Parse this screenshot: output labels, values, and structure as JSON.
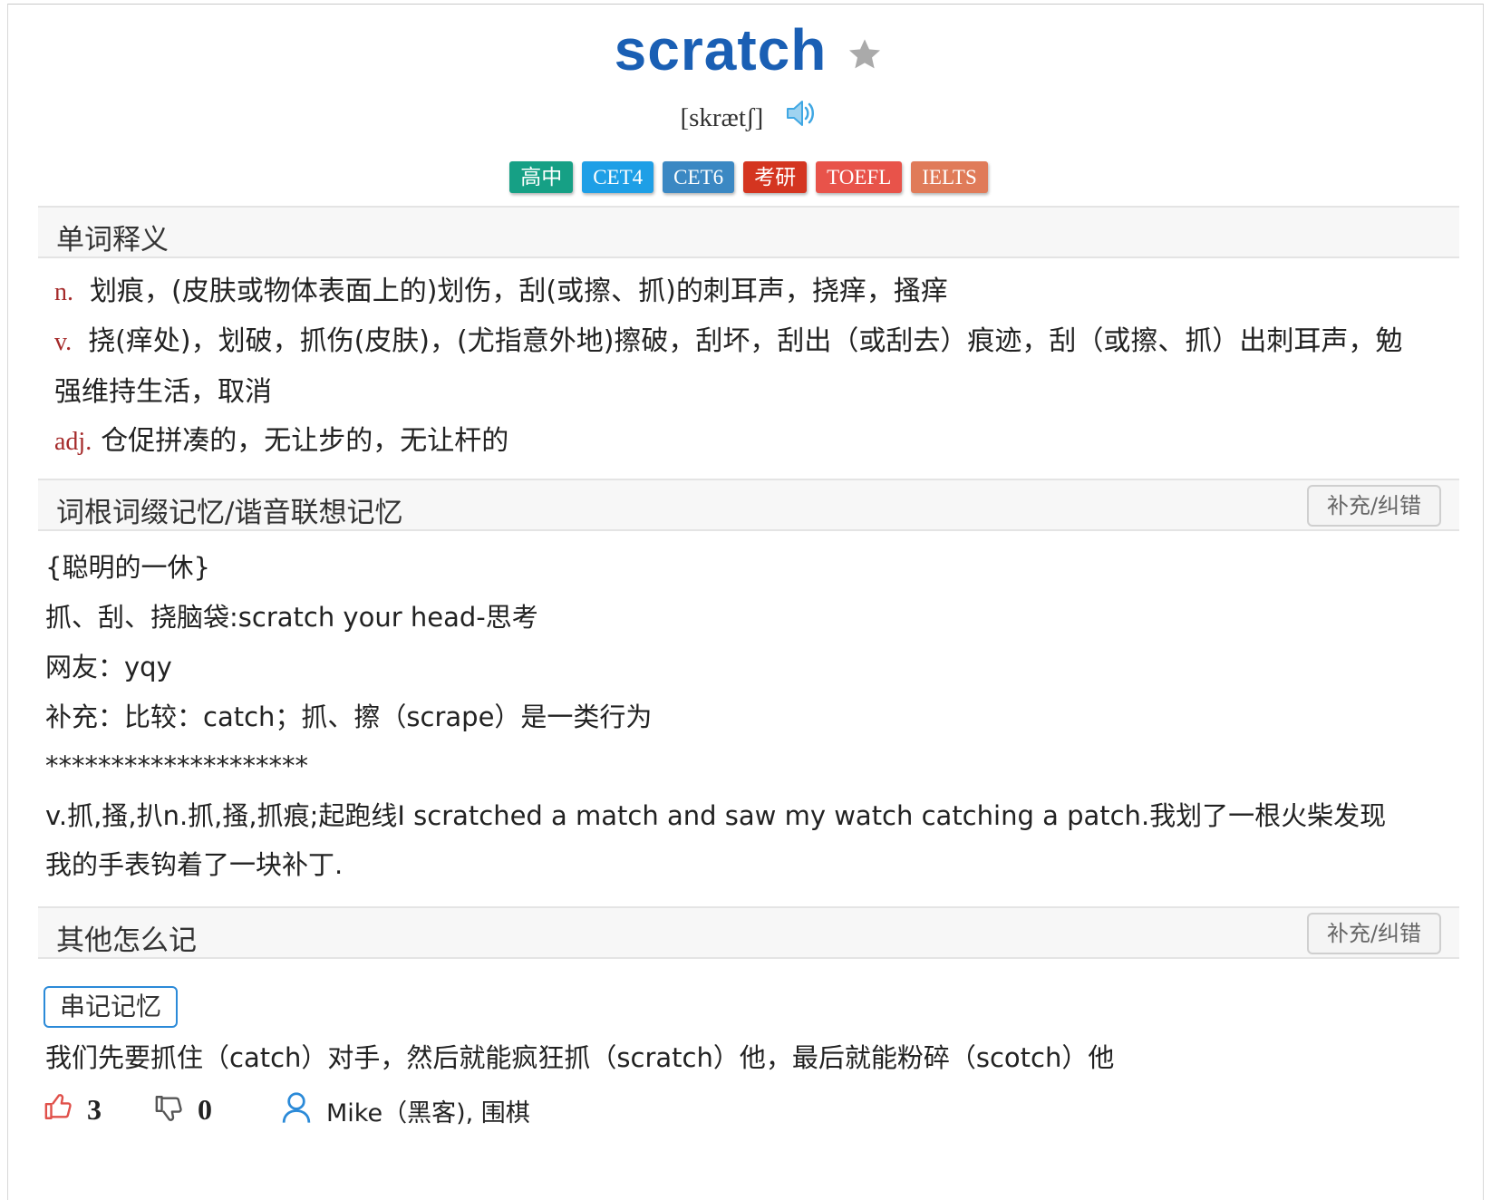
{
  "word": {
    "text": "scratch",
    "favorite_icon": "star-icon",
    "phonetic": "[skrætʃ]",
    "audio_icon": "speaker-icon",
    "tags": [
      {
        "label": "高中",
        "color": "#16a085"
      },
      {
        "label": "CET4",
        "color": "#1e9fe6"
      },
      {
        "label": "CET6",
        "color": "#3b88c3"
      },
      {
        "label": "考研",
        "color": "#d43520"
      },
      {
        "label": "TOEFL",
        "color": "#e8534a"
      },
      {
        "label": "IELTS",
        "color": "#e07b59"
      }
    ]
  },
  "definitions": {
    "title": "单词释义",
    "items": [
      {
        "pos": "n.",
        "text": "划痕，(皮肤或物体表面上的)划伤，刮(或擦、抓)的刺耳声，挠痒，搔痒"
      },
      {
        "pos": "v.",
        "text": "挠(痒处)，划破，抓伤(皮肤)，(尤指意外地)擦破，刮坏，刮出（或刮去）痕迹，刮（或擦、抓）出刺耳声，勉强维持生活，取消"
      },
      {
        "pos": "adj.",
        "text": "仓促拼凑的，无让步的，无让杆的"
      }
    ]
  },
  "root_memory": {
    "title": "词根词缀记忆/谐音联想记忆",
    "fix_label": "补充/纠错",
    "lines": [
      "{聪明的一休}",
      "抓、刮、挠脑袋:scratch your head-思考",
      "网友：yqy",
      "补充：比较：catch；抓、擦（scrape）是一类行为",
      "********************",
      "v.抓,搔,扒n.抓,搔,抓痕;起跑线I scratched a match and saw my watch catching a patch.我划了一根火柴发现我的手表钩着了一块补丁."
    ]
  },
  "other_memory": {
    "title": "其他怎么记",
    "fix_label": "补充/纠错",
    "pill_label": "串记记忆",
    "text": "我们先要抓住（catch）对手，然后就能疯狂抓（scratch）他，最后就能粉碎（scotch）他",
    "likes": "3",
    "dislikes": "0",
    "author": "Mike（黑客), 围棋"
  }
}
